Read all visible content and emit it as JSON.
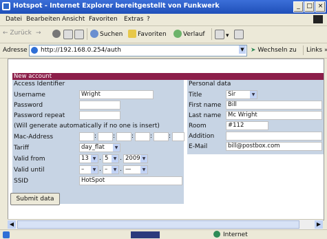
{
  "window": {
    "title": "Hotspot - Internet Explorer bereitgestellt von Funkwerk",
    "buttons": {
      "minimize": "_",
      "maximize": "□",
      "close": "×"
    }
  },
  "menu": [
    "Datei",
    "Bearbeiten",
    "Ansicht",
    "Favoriten",
    "Extras",
    "?"
  ],
  "toolbar": {
    "back": "Zurück",
    "search": "Suchen",
    "favorites": "Favoriten",
    "history": "Verlauf"
  },
  "address": {
    "label": "Adresse",
    "url": "http://192.168.0.254/auth",
    "go": "Wechseln zu",
    "links": "Links"
  },
  "form": {
    "header": "New account",
    "left_title": "Access Identifier",
    "right_title": "Personal data",
    "username_label": "Username",
    "username_value": "Wright",
    "password_label": "Password",
    "password_value": "",
    "password_repeat_label": "Password repeat",
    "password_repeat_value": "",
    "generate_note": "(Will generate automatically if no one is insert)",
    "mac_label": "Mac-Address",
    "tariff_label": "Tariff",
    "tariff_value": "day_flat",
    "valid_from_label": "Valid from",
    "valid_from": {
      "day": "13",
      "month": "5",
      "year": "2009"
    },
    "valid_until_label": "Valid until",
    "valid_until": {
      "day": "–",
      "month": "–",
      "year": "—"
    },
    "ssid_label": "SSID",
    "ssid_value": "HotSpot",
    "submit": "Submit data",
    "title_label": "Title",
    "title_value": "Sir",
    "first_name_label": "First name",
    "first_name_value": "Bill",
    "last_name_label": "Last name",
    "last_name_value": "Mc Wright",
    "room_label": "Room",
    "room_value": "#112",
    "addition_label": "Addition",
    "addition_value": "",
    "email_label": "E-Mail",
    "email_value": "bill@postbox.com"
  },
  "status": {
    "zone": "Internet"
  },
  "colors": {
    "header_bar": "#8c1f4a",
    "panel": "#c7d4e4",
    "titlebar": "#2456c5"
  }
}
